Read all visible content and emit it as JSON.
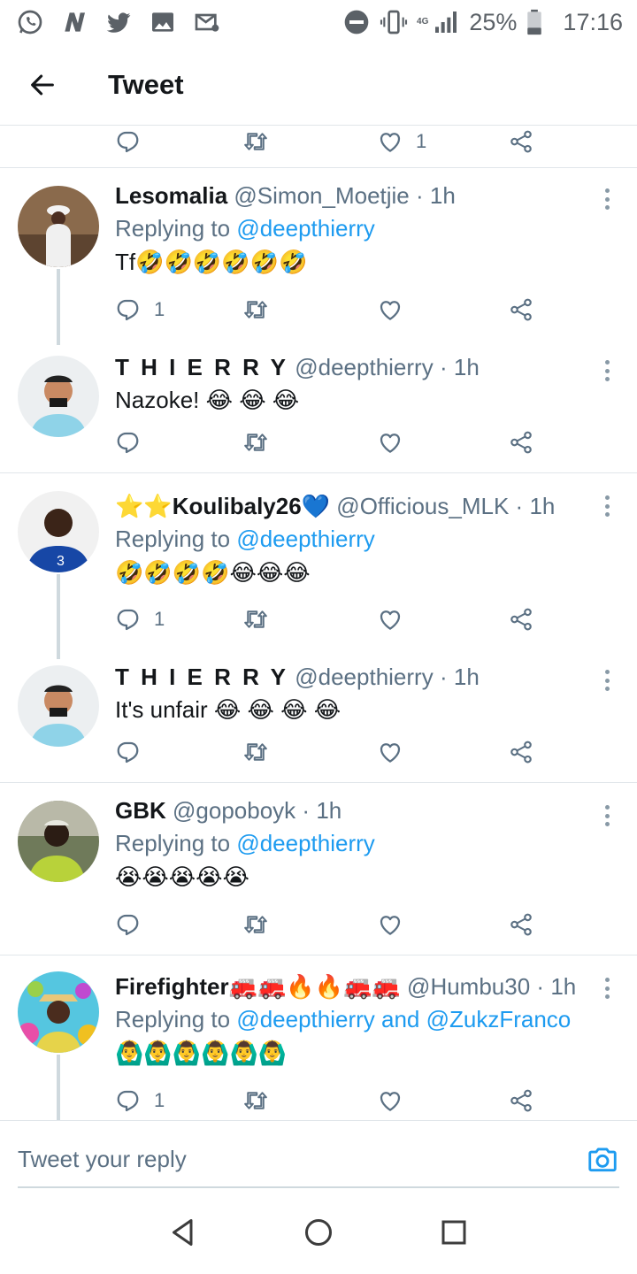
{
  "status_bar": {
    "left_icons": [
      "whatsapp-icon",
      "news-icon",
      "twitter-icon",
      "gallery-icon",
      "mail-icon"
    ],
    "network": "4G",
    "battery": "25%",
    "time": "17:16"
  },
  "header": {
    "title": "Tweet"
  },
  "top_actions": {
    "like_count": "1"
  },
  "tweets": [
    {
      "name": "Lesomalia",
      "handle": "@Simon_Moetjie",
      "dot": "·",
      "time": "1h",
      "replying_prefix": "Replying to",
      "replying_to": "@deepthierry",
      "text": "Tf🤣🤣🤣🤣🤣🤣",
      "reply_count": "1"
    },
    {
      "name": "T H I E R R Y",
      "handle": "@deepthierry",
      "dot": "·",
      "time": "1h",
      "text": "Nazoke! 😂 😂 😂"
    },
    {
      "name": "⭐⭐Koulibaly26💙",
      "handle": "@Officious_MLK",
      "dot": "·",
      "time": "1h",
      "replying_prefix": "Replying to",
      "replying_to": "@deepthierry",
      "text": "🤣🤣🤣🤣😂😂😂",
      "reply_count": "1"
    },
    {
      "name": "T H I E R R Y",
      "handle": "@deepthierry",
      "dot": "·",
      "time": "1h",
      "text": "It's unfair 😂 😂 😂 😂"
    },
    {
      "name": "GBK",
      "handle": "@gopoboyk",
      "dot": "·",
      "time": "1h",
      "replying_prefix": "Replying to",
      "replying_to": "@deepthierry",
      "text": "😭😭😭😭😭"
    },
    {
      "name": "Firefighter🚒🚒🔥🔥🚒🚒",
      "handle": "@Humbu30",
      "dot": "·",
      "time": "1h",
      "replying_prefix": "Replying to",
      "replying_to": "@deepthierry and @ZukzFranco",
      "text": "🙆‍♂️🙆‍♂️🙆‍♂️🙆‍♂️🙆‍♂️🙆‍♂️",
      "reply_count": "1"
    }
  ],
  "composer": {
    "placeholder": "Tweet your reply"
  },
  "colors": {
    "accent": "#1d9bf0",
    "secondary_text": "#5b7083",
    "divider": "#e1e6ea"
  }
}
